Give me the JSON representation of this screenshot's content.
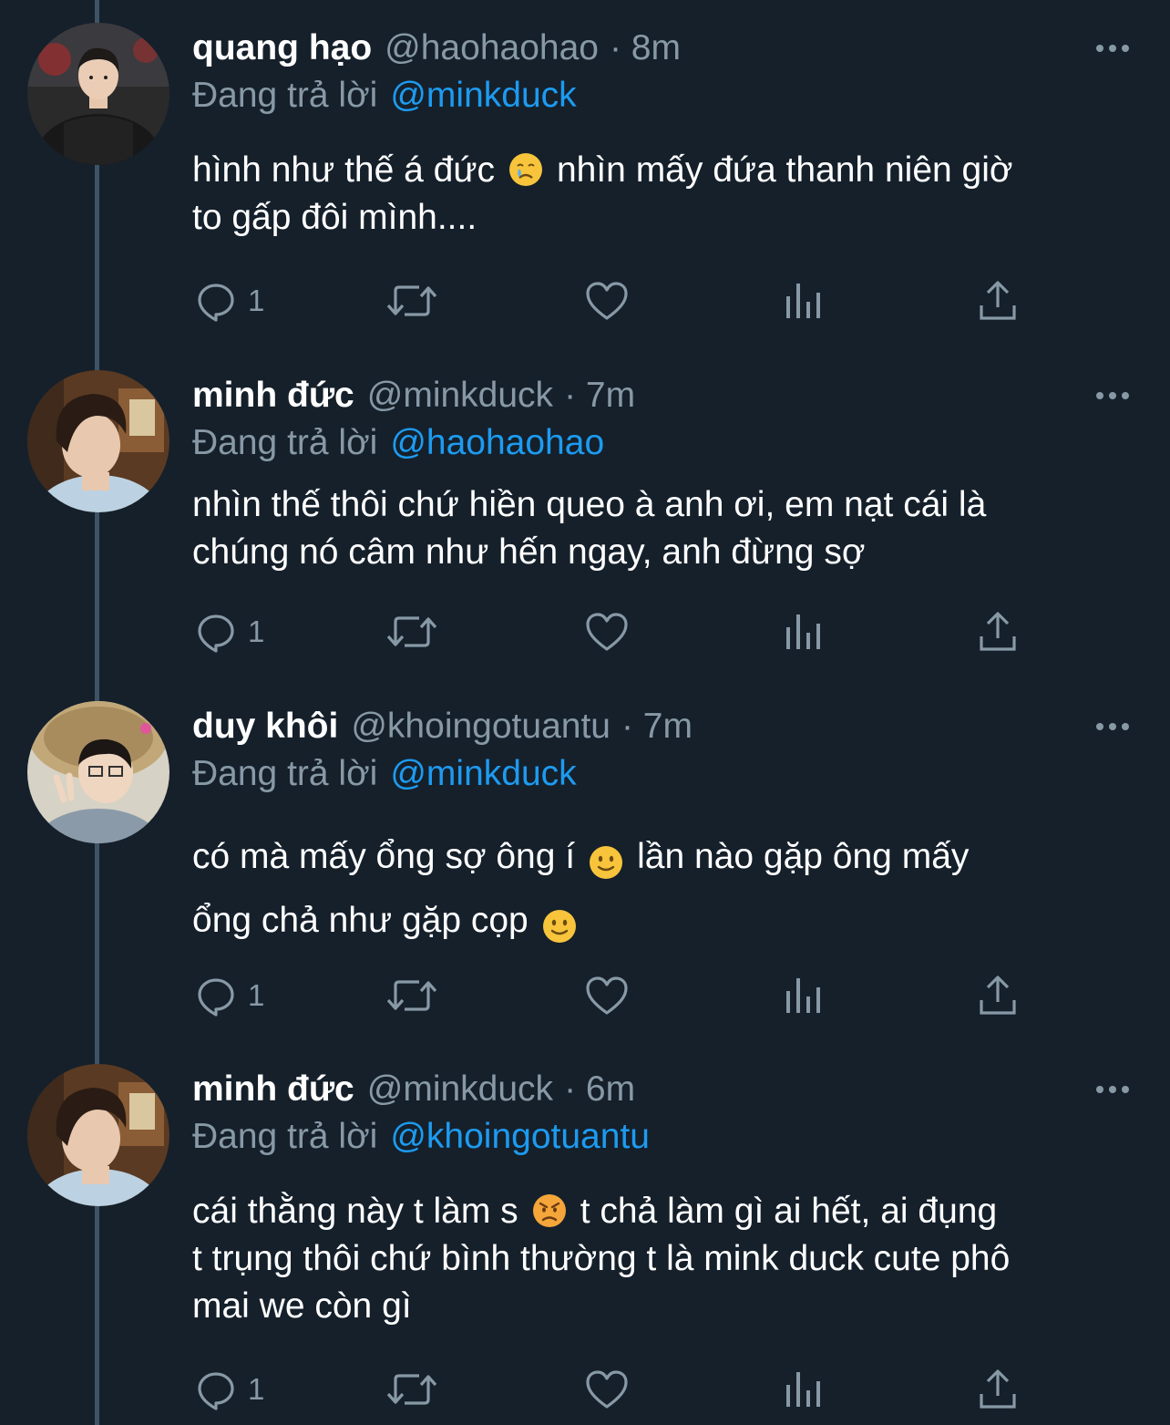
{
  "colors": {
    "background": "#15202b",
    "text_primary": "#ffffff",
    "text_secondary": "#8899a6",
    "mention": "#1d9bf0",
    "thread_line": "#3d5466"
  },
  "reply_prefix": "Đang trả lời",
  "tweets": [
    {
      "display_name": "quang hạo",
      "handle": "@haohaohao",
      "time": "· 8m",
      "reply_to": "@minkduck",
      "text_line1_a": "hình như thế á đức",
      "emoji1": "crying-face-icon",
      "text_line1_b": "nhìn mấy đứa thanh niên giờ",
      "text_line2": "to gấp đôi mình....",
      "reply_count": "1"
    },
    {
      "display_name": "minh đức",
      "handle": "@minkduck",
      "time": "· 7m",
      "reply_to": "@haohaohao",
      "text_line1": "nhìn thế thôi chứ hiền queo à anh ơi, em nạt cái là",
      "text_line2": "chúng nó câm như hến ngay, anh đừng sợ",
      "reply_count": "1"
    },
    {
      "display_name": "duy khôi",
      "handle": "@khoingotuantu",
      "time": "· 7m",
      "reply_to": "@minkduck",
      "text_line1_a": "có mà mấy ổng sợ ông í",
      "emoji1": "slightly-smiling-face-icon",
      "text_line1_b": "lần nào gặp ông mấy",
      "text_line2_a": "ổng chả như gặp cọp",
      "emoji2": "slightly-smiling-face-icon",
      "reply_count": "1"
    },
    {
      "display_name": "minh đức",
      "handle": "@minkduck",
      "time": "· 6m",
      "reply_to": "@khoingotuantu",
      "text_line1_a": "cái thằng này t làm s",
      "emoji1": "angry-face-icon",
      "text_line1_b": "t chả làm gì ai hết, ai đụng",
      "text_line2": "t trụng thôi chứ bình thường t là mink duck cute phô",
      "text_line3": "mai we còn gì",
      "reply_count": "1"
    }
  ]
}
